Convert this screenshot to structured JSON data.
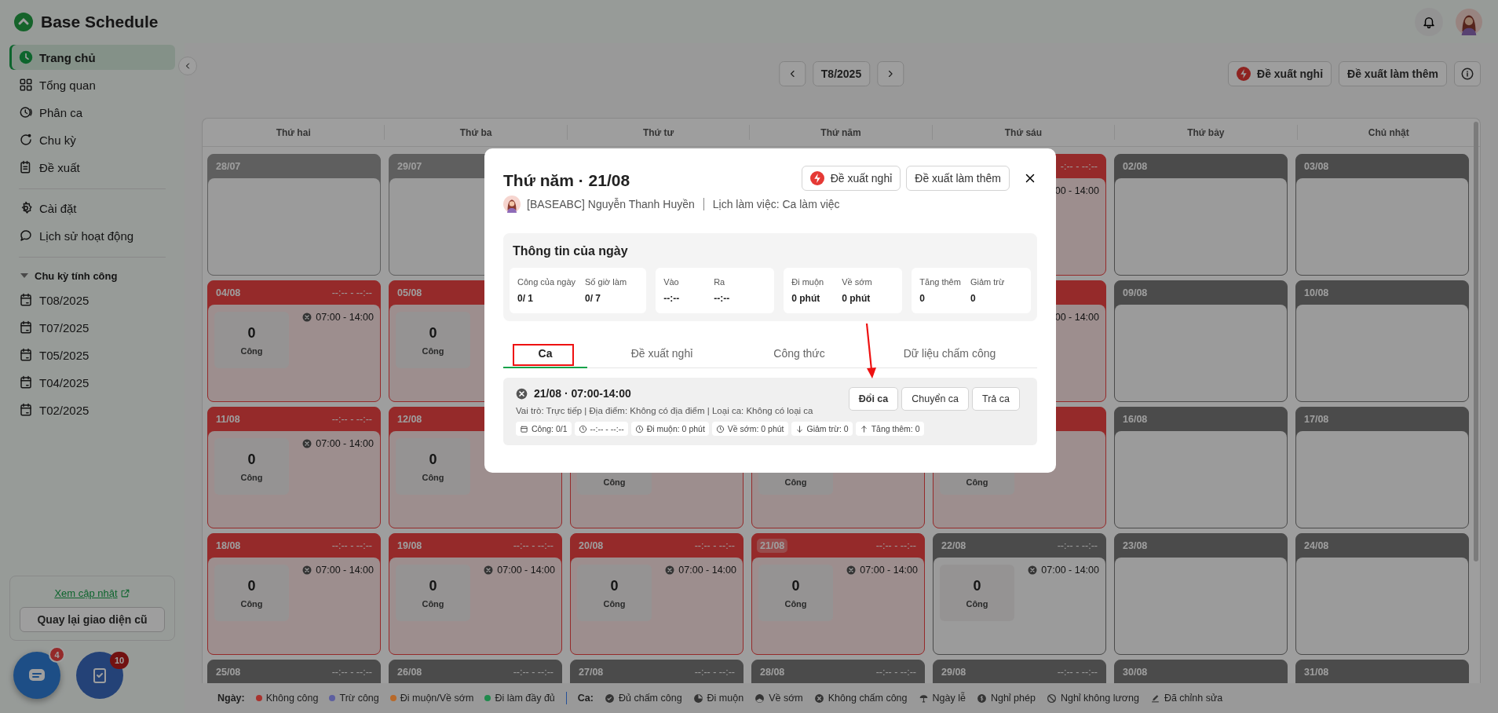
{
  "app": {
    "title": "Base Schedule"
  },
  "sidebar": {
    "items": [
      {
        "label": "Trang chủ",
        "selected": true
      },
      {
        "label": "Tổng quan",
        "selected": false
      },
      {
        "label": "Phân ca",
        "selected": false
      },
      {
        "label": "Chu kỳ",
        "selected": false
      },
      {
        "label": "Đề xuất",
        "selected": false
      },
      {
        "label": "Cài đặt",
        "selected": false
      },
      {
        "label": "Lịch sử hoạt động",
        "selected": false
      }
    ],
    "section": {
      "label": "Chu kỳ tính công",
      "expanded": true,
      "items": [
        {
          "label": "T08/2025",
          "selected": false
        },
        {
          "label": "T07/2025",
          "selected": false
        },
        {
          "label": "T05/2025",
          "selected": false
        },
        {
          "label": "T04/2025",
          "selected": false
        },
        {
          "label": "T02/2025",
          "selected": false
        }
      ]
    },
    "update_link": "Xem cập nhật",
    "old_ui_button": "Quay lại giao diện cũ"
  },
  "fabs": [
    {
      "badge": "4"
    },
    {
      "badge": "10"
    }
  ],
  "toolbar": {
    "month": "T8/2025",
    "actions": [
      "Đề xuất nghỉ",
      "Đề xuất làm thêm"
    ]
  },
  "calendar": {
    "weekdays": [
      "Thứ hai",
      "Thứ ba",
      "Thứ tư",
      "Thứ năm",
      "Thứ sáu",
      "Thứ bảy",
      "Chủ nhật"
    ],
    "weeks": [
      [
        {
          "date": "28/07",
          "kind": "other-month",
          "today": false
        },
        {
          "date": "29/07",
          "kind": "other-month",
          "today": false
        },
        {
          "kind": "covered"
        },
        {
          "kind": "covered"
        },
        {
          "kind": "absent",
          "time": "-:-- - --:--",
          "shift": {
            "hours": "00 - 14:00"
          }
        },
        {
          "date": "02/08",
          "kind": "free",
          "today": false
        },
        {
          "date": "03/08",
          "kind": "free",
          "today": false
        }
      ],
      [
        {
          "date": "04/08",
          "kind": "absent",
          "time": "--:-- - --:--",
          "shift": {
            "count": "0",
            "unit": "Công",
            "hours": "07:00 - 14:00"
          },
          "today": false
        },
        {
          "date": "05/08",
          "kind": "absent",
          "shift": {
            "count": "0",
            "unit": "Công"
          },
          "today": false
        },
        {
          "kind": "covered"
        },
        {
          "kind": "covered"
        },
        {
          "kind": "absent",
          "shift": {
            "hours": "00 - 14:00"
          }
        },
        {
          "date": "09/08",
          "kind": "free",
          "today": false
        },
        {
          "date": "10/08",
          "kind": "free",
          "today": false
        }
      ],
      [
        {
          "date": "11/08",
          "kind": "absent",
          "time": "--:-- - --:--",
          "shift": {
            "count": "0",
            "unit": "Công",
            "hours": "07:00 - 14:00"
          },
          "today": false
        },
        {
          "date": "12/08",
          "kind": "absent",
          "shift": {
            "count": "0",
            "unit": "Công"
          },
          "today": false
        },
        {
          "kind": "absent",
          "shift": {
            "unit": "Công"
          }
        },
        {
          "kind": "absent",
          "shift": {
            "unit": "Công"
          }
        },
        {
          "kind": "absent",
          "shift": {
            "unit": "Công"
          }
        },
        {
          "date": "16/08",
          "kind": "free",
          "today": false
        },
        {
          "date": "17/08",
          "kind": "free",
          "today": false
        }
      ],
      [
        {
          "date": "18/08",
          "kind": "absent",
          "time": "--:-- - --:--",
          "shift": {
            "count": "0",
            "unit": "Công",
            "hours": "07:00 - 14:00"
          },
          "today": false
        },
        {
          "date": "19/08",
          "kind": "absent",
          "time": "--:-- - --:--",
          "shift": {
            "count": "0",
            "unit": "Công",
            "hours": "07:00 - 14:00"
          },
          "today": false
        },
        {
          "date": "20/08",
          "kind": "absent",
          "time": "--:-- - --:--",
          "shift": {
            "count": "0",
            "unit": "Công",
            "hours": "07:00 - 14:00"
          },
          "today": false
        },
        {
          "date": "21/08",
          "kind": "absent",
          "time": "--:-- - --:--",
          "shift": {
            "count": "0",
            "unit": "Công",
            "hours": "07:00 - 14:00"
          },
          "today": true
        },
        {
          "date": "22/08",
          "kind": "scheduled",
          "time": "--:-- - --:--",
          "shift": {
            "count": "0",
            "unit": "Công",
            "hours": "07:00 - 14:00"
          },
          "today": false
        },
        {
          "date": "23/08",
          "kind": "free",
          "today": false
        },
        {
          "date": "24/08",
          "kind": "free",
          "today": false
        }
      ],
      [
        {
          "date": "25/08",
          "kind": "scheduled",
          "time": "--:-- - --:--",
          "today": false
        },
        {
          "date": "26/08",
          "kind": "scheduled",
          "time": "--:-- - --:--",
          "today": false
        },
        {
          "date": "27/08",
          "kind": "scheduled",
          "time": "--:-- - --:--",
          "today": false
        },
        {
          "date": "28/08",
          "kind": "scheduled",
          "time": "--:-- - --:--",
          "today": false
        },
        {
          "date": "29/08",
          "kind": "scheduled",
          "time": "--:-- - --:--",
          "today": false
        },
        {
          "date": "30/08",
          "kind": "free",
          "today": false
        },
        {
          "date": "31/08",
          "kind": "free",
          "today": false
        }
      ]
    ]
  },
  "legend": {
    "day_label": "Ngày:",
    "day_items": [
      {
        "label": "Không công",
        "color": "#a8322d"
      },
      {
        "label": "Trừ công",
        "color": "#5d5fa0"
      },
      {
        "label": "Đi muộn/Về sớm",
        "color": "#b8692a"
      },
      {
        "label": "Đi làm đầy đủ",
        "color": "#1f8a4c"
      }
    ],
    "shift_label": "Ca:",
    "shift_items": [
      "Đủ chấm công",
      "Đi muộn",
      "Về sớm",
      "Không chấm công",
      "Ngày lễ",
      "Nghỉ phép",
      "Nghỉ không lương",
      "Đã chỉnh sửa"
    ]
  },
  "modal": {
    "title": "Thứ năm · 21/08",
    "actions": [
      "Đề xuất nghỉ",
      "Đề xuất làm thêm"
    ],
    "employee": "[BASEABC] Nguyễn Thanh Huyền",
    "schedule": "Lịch làm việc: Ca làm việc",
    "day_info": {
      "title": "Thông tin của ngày",
      "groups": [
        [
          {
            "label": "Công của ngày",
            "value": "0/ 1"
          },
          {
            "label": "Số giờ làm",
            "value": "0/ 7"
          }
        ],
        [
          {
            "label": "Vào",
            "value": "--:--"
          },
          {
            "label": "Ra",
            "value": "--:--"
          }
        ],
        [
          {
            "label": "Đi muộn",
            "value": "0 phút"
          },
          {
            "label": "Về sớm",
            "value": "0 phút"
          }
        ],
        [
          {
            "label": "Tăng thêm",
            "value": "0"
          },
          {
            "label": "Giảm trừ",
            "value": "0"
          }
        ]
      ]
    },
    "tabs": [
      {
        "label": "Ca",
        "selected": true
      },
      {
        "label": "Đề xuất nghỉ",
        "selected": false
      },
      {
        "label": "Công thức",
        "selected": false
      },
      {
        "label": "Dữ liệu chấm công",
        "selected": false
      }
    ],
    "shift": {
      "title": "21/08 · 07:00-14:00",
      "details": "Vai trò: Trực tiếp | Địa điểm: Không có địa điểm | Loại ca: Không có loại ca",
      "chips": [
        "Công: 0/1",
        "--:-- - --:--",
        "Đi muộn: 0 phút",
        "Về sớm: 0 phút",
        "Giảm trừ: 0",
        "Tăng thêm: 0"
      ],
      "actions": [
        "Đổi ca",
        "Chuyển ca",
        "Trả ca"
      ]
    }
  }
}
